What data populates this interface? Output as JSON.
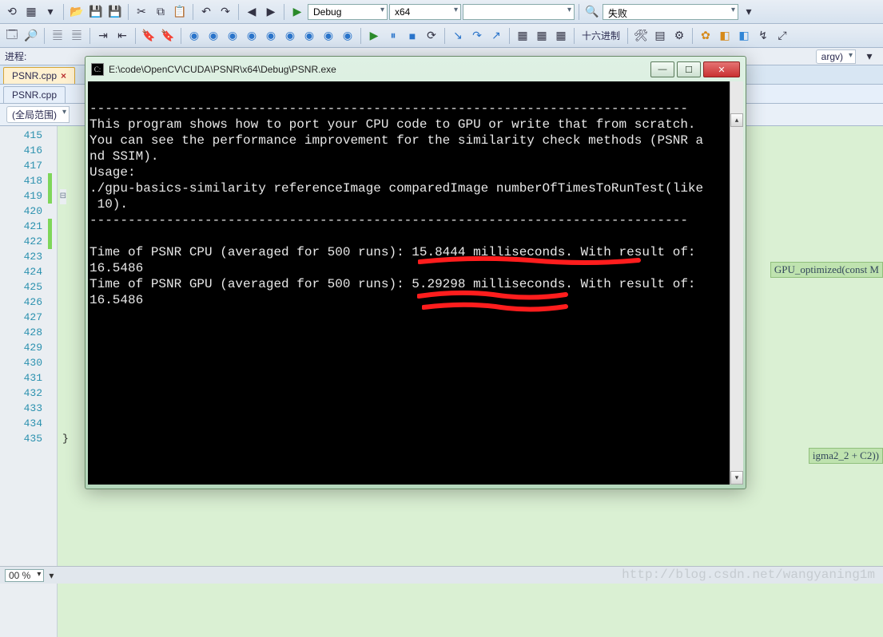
{
  "toolbar": {
    "config_dd": "Debug",
    "platform_dd": "x64",
    "status_dd": "失败",
    "encoding_label": "十六进制",
    "argv_pill": "argv)"
  },
  "process_row": {
    "label": "进程:"
  },
  "tabs": {
    "main": "PSNR.cpp",
    "shadow": "PSNR.cpp"
  },
  "crumb": {
    "scope": "(全局范围)"
  },
  "gutter": {
    "start": 415,
    "end": 435,
    "modified": [
      418,
      419,
      421,
      422
    ],
    "fold": [
      419
    ]
  },
  "code": {
    "end_brace": "}",
    "snippet_fn": "GPU_optimized(const M",
    "snippet_expr": "igma2_2 + C2))"
  },
  "console": {
    "title": "E:\\code\\OpenCV\\CUDA\\PSNR\\x64\\Debug\\PSNR.exe",
    "lines": [
      "",
      "------------------------------------------------------------------------------",
      "This program shows how to port your CPU code to GPU or write that from scratch.",
      "You can see the performance improvement for the similarity check methods (PSNR a",
      "nd SSIM).",
      "Usage:",
      "./gpu-basics-similarity referenceImage comparedImage numberOfTimesToRunTest(like",
      " 10).",
      "------------------------------------------------------------------------------",
      "",
      "Time of PSNR CPU (averaged for 500 runs): 15.8444 milliseconds. With result of:",
      "16.5486",
      "Time of PSNR GPU (averaged for 500 runs): 5.29298 milliseconds. With result of:",
      "16.5486"
    ]
  },
  "footer": {
    "zoom": "00 %"
  },
  "watermark": "http://blog.csdn.net/wangyaning1m"
}
